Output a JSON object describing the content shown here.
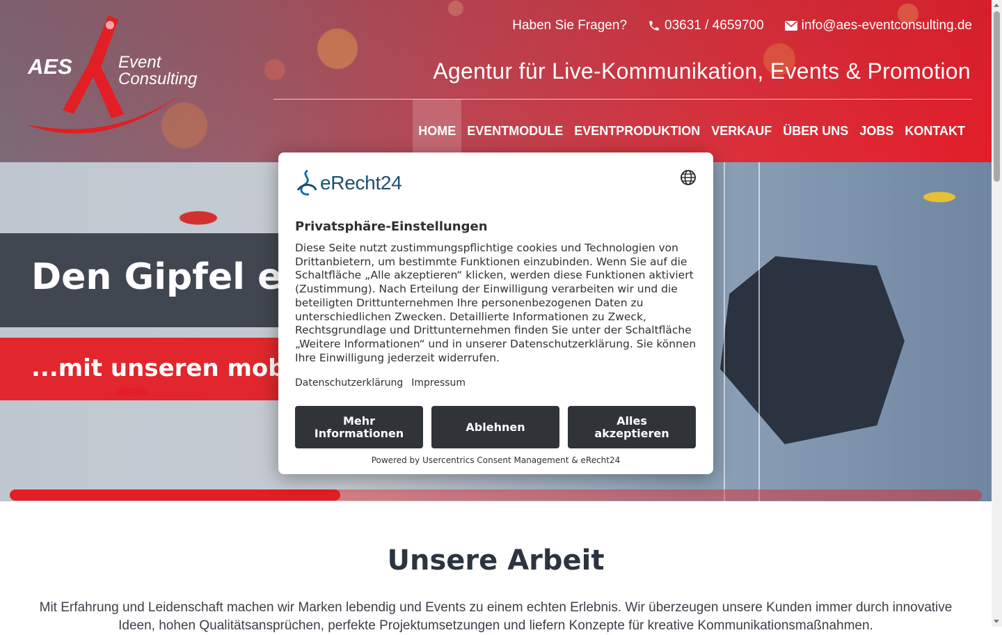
{
  "header": {
    "contact": {
      "question": "Haben Sie Fragen?",
      "phone": "03631 / 4659700",
      "email": "info@aes-eventconsulting.de"
    },
    "tagline": "Agentur für Live-Kommunikation, Events & Promotion",
    "logo_text": {
      "aes": "AES",
      "event": "Event",
      "consulting": "Consulting"
    },
    "nav": [
      "HOME",
      "EVENTMODULE",
      "EVENTPRODUKTION",
      "VERKAUF",
      "ÜBER UNS",
      "JOBS",
      "KONTAKT"
    ],
    "active_nav": "HOME"
  },
  "hero": {
    "title": "Den Gipfel err",
    "subtitle": "...mit unseren mobile",
    "slider_progress": 0.34
  },
  "section": {
    "title": "Unsere Arbeit",
    "text": "Mit Erfahrung und Leidenschaft machen wir Marken lebendig und Events zu einem echten Erlebnis. Wir überzeugen unsere Kunden immer durch innovative Ideen, hohen Qualitätsansprüchen, perfekte Projektumsetzungen und liefern Konzepte für kreative Kommunikationsmaßnahmen."
  },
  "consent": {
    "logo": "eRecht24",
    "heading": "Privatsphäre-Einstellungen",
    "body": "Diese Seite nutzt zustimmungspflichtige cookies und Technologien von Drittanbietern, um bestimmte Funktionen einzubinden. Wenn Sie auf die Schaltfläche „Alle akzeptieren“ klicken, werden diese Funktionen aktiviert (Zustimmung). Nach Erteilung der Einwilligung verarbeiten wir und die beteiligten Drittunternehmen Ihre personenbezogenen Daten zu unterschiedlichen Zwecken. Detaillierte Informationen zu Zweck, Rechtsgrundlage und Drittunternehmen finden Sie unter der Schaltfläche „Weitere Informationen“ und in unserer Datenschutzerklärung. Sie können Ihre Einwilligung jederzeit widerrufen.",
    "links": {
      "privacy": "Datenschutzerklärung",
      "imprint": "Impressum"
    },
    "buttons": {
      "more": "Mehr Informationen",
      "decline": "Ablehnen",
      "accept": "Alles akzeptieren"
    },
    "footer": "Powered by Usercentrics Consent Management & eRecht24"
  },
  "colors": {
    "brand_red": "#e31e24",
    "dark": "#303338",
    "erecht_blue": "#1b4f72"
  },
  "icons": {
    "phone": "phone-icon",
    "email": "envelope-icon",
    "language": "globe-icon"
  }
}
